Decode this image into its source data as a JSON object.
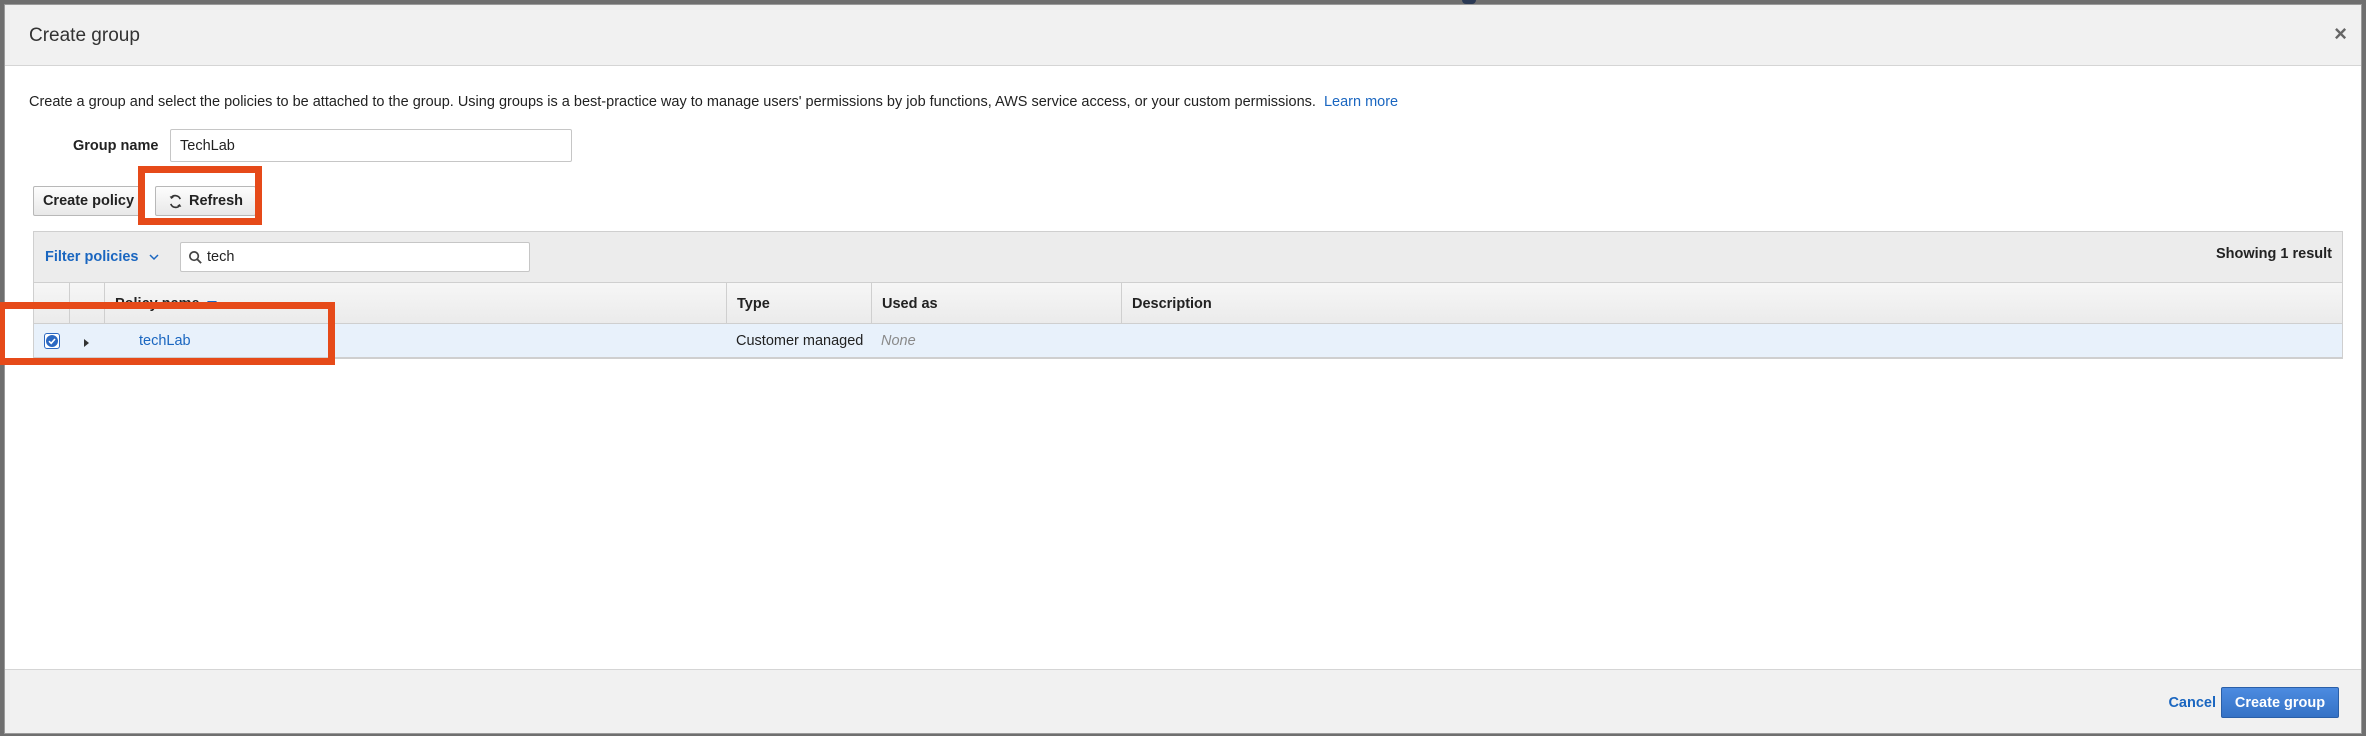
{
  "dialog": {
    "title": "Create group",
    "close_icon": "close-icon",
    "intro_text": "Create a group and select the policies to be attached to the group. Using groups is a best-practice way to manage users' permissions by job functions, AWS service access, or your custom permissions.",
    "learn_more": "Learn more"
  },
  "group_name": {
    "label": "Group name",
    "value": "TechLab"
  },
  "toolbar": {
    "create_policy": "Create policy",
    "refresh": "Refresh",
    "refresh_icon": "refresh-icon"
  },
  "filter": {
    "label": "Filter policies",
    "search_value": "tech",
    "showing": "Showing 1 result"
  },
  "table": {
    "columns": [
      "Policy name",
      "Type",
      "Used as",
      "Description"
    ],
    "rows": [
      {
        "checked": true,
        "name": "techLab",
        "type": "Customer managed",
        "used_as": "None",
        "description": ""
      }
    ]
  },
  "footer": {
    "cancel": "Cancel",
    "create_group": "Create group"
  },
  "colors": {
    "link": "#1a66c0",
    "highlight": "#e64a19",
    "primary_button": "#3572c6",
    "selected_row": "#e8f1fb"
  }
}
